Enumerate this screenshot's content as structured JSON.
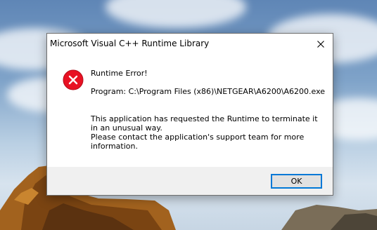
{
  "dialog": {
    "title": "Microsoft Visual C++ Runtime Library",
    "heading": "Runtime Error!",
    "program_line": "Program: C:\\Program Files (x86)\\NETGEAR\\A6200\\A6200.exe",
    "message_line1": "This application has requested the Runtime to terminate it in an unusual way.",
    "message_line2": "Please contact the application's support team for more information.",
    "ok_label": "OK",
    "icon": "error-icon",
    "close_icon": "close-icon"
  },
  "colors": {
    "error_red": "#e81123",
    "accent_blue": "#0078d7",
    "footer_gray": "#f0f0f0"
  }
}
